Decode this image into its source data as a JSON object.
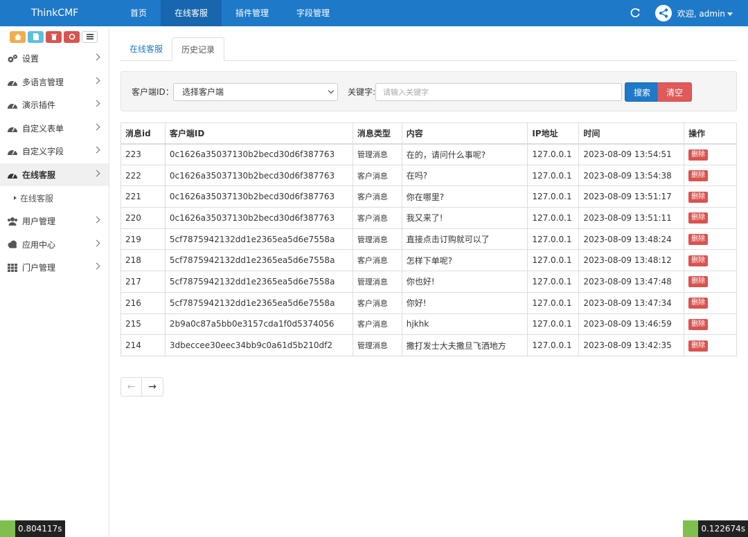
{
  "brand": "ThinkCMF",
  "nav": [
    {
      "label": "首页",
      "active": false
    },
    {
      "label": "在线客服",
      "active": true
    },
    {
      "label": "插件管理",
      "active": false
    },
    {
      "label": "字段管理",
      "active": false
    }
  ],
  "user": {
    "welcome": "欢迎, admin"
  },
  "sidebar": {
    "items": [
      {
        "label": "设置",
        "icon": "gears-icon"
      },
      {
        "label": "多语言管理",
        "icon": "dashboard-icon"
      },
      {
        "label": "演示插件",
        "icon": "dashboard-icon"
      },
      {
        "label": "自定义表单",
        "icon": "dashboard-icon"
      },
      {
        "label": "自定义字段",
        "icon": "dashboard-icon"
      },
      {
        "label": "在线客服",
        "icon": "dashboard-icon"
      },
      {
        "label": "用户管理",
        "icon": "users-icon"
      },
      {
        "label": "应用中心",
        "icon": "cloud-icon"
      },
      {
        "label": "门户管理",
        "icon": "grid-icon"
      }
    ],
    "sub_item": "在线客服"
  },
  "tabs": [
    "在线客服",
    "历史记录"
  ],
  "filter": {
    "client_label": "客户端ID：",
    "client_selected": "选择客户端",
    "keyword_label": "关键字:",
    "keyword_placeholder": "请输入关键字",
    "search_label": "搜索",
    "clear_label": "清空"
  },
  "table": {
    "headers": [
      "消息id",
      "客户端ID",
      "消息类型",
      "内容",
      "IP地址",
      "时间",
      "操作"
    ],
    "rows": [
      {
        "id": "223",
        "client": "0c1626a35037130b2becd30d6f387763",
        "type": "管理消息",
        "content": "在的，请问什么事呢?",
        "ip": "127.0.0.1",
        "time": "2023-08-09 13:54:51",
        "action": "删除"
      },
      {
        "id": "222",
        "client": "0c1626a35037130b2becd30d6f387763",
        "type": "客户消息",
        "content": "在吗?",
        "ip": "127.0.0.1",
        "time": "2023-08-09 13:54:38",
        "action": "删除"
      },
      {
        "id": "221",
        "client": "0c1626a35037130b2becd30d6f387763",
        "type": "客户消息",
        "content": "你在哪里?",
        "ip": "127.0.0.1",
        "time": "2023-08-09 13:51:17",
        "action": "删除"
      },
      {
        "id": "220",
        "client": "0c1626a35037130b2becd30d6f387763",
        "type": "客户消息",
        "content": "我又来了!",
        "ip": "127.0.0.1",
        "time": "2023-08-09 13:51:11",
        "action": "删除"
      },
      {
        "id": "219",
        "client": "5cf7875942132dd1e2365ea5d6e7558a",
        "type": "管理消息",
        "content": "直接点击订购就可以了",
        "ip": "127.0.0.1",
        "time": "2023-08-09 13:48:24",
        "action": "删除"
      },
      {
        "id": "218",
        "client": "5cf7875942132dd1e2365ea5d6e7558a",
        "type": "客户消息",
        "content": "怎样下单呢?",
        "ip": "127.0.0.1",
        "time": "2023-08-09 13:48:12",
        "action": "删除"
      },
      {
        "id": "217",
        "client": "5cf7875942132dd1e2365ea5d6e7558a",
        "type": "管理消息",
        "content": "你也好!",
        "ip": "127.0.0.1",
        "time": "2023-08-09 13:47:48",
        "action": "删除"
      },
      {
        "id": "216",
        "client": "5cf7875942132dd1e2365ea5d6e7558a",
        "type": "客户消息",
        "content": "你好!",
        "ip": "127.0.0.1",
        "time": "2023-08-09 13:47:34",
        "action": "删除"
      },
      {
        "id": "215",
        "client": "2b9a0c87a5bb0e3157cda1f0d5374056",
        "type": "客户消息",
        "content": "hjkhk",
        "ip": "127.0.0.1",
        "time": "2023-08-09 13:46:59",
        "action": "删除"
      },
      {
        "id": "214",
        "client": "3dbeccee30eec34bb9c0a61d5b210df2",
        "type": "管理消息",
        "content": "撒打发士大夫撒旦飞洒地方",
        "ip": "127.0.0.1",
        "time": "2023-08-09 13:42:35",
        "action": "删除"
      }
    ]
  },
  "pager": {
    "prev": "←",
    "next": "→"
  },
  "debug": {
    "left": "0.804117s",
    "right": "0.122674s"
  },
  "colors": {
    "primary": "#1e7ac8",
    "danger": "#d9534f"
  }
}
